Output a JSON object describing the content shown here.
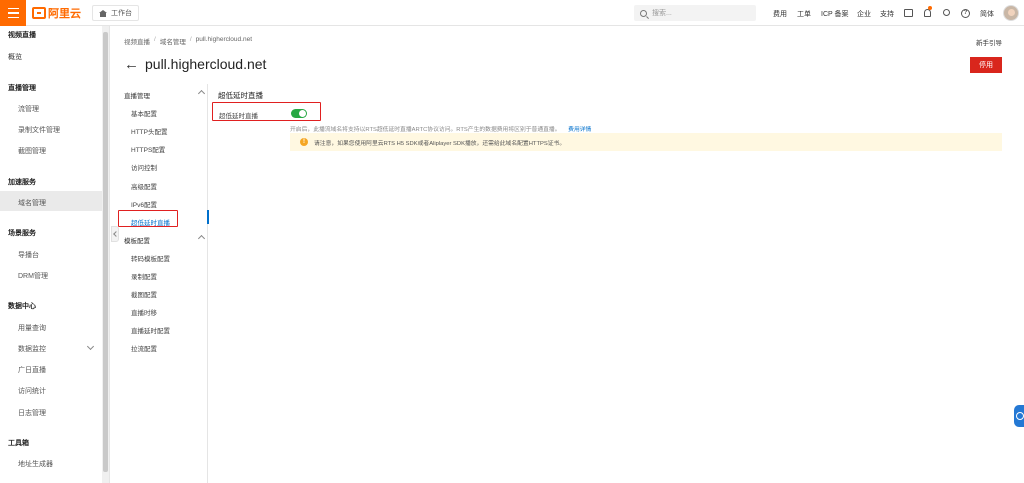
{
  "topbar": {
    "logo_text": "阿里云",
    "workbench_label": "工作台",
    "search_placeholder": "搜索...",
    "nav": [
      "费用",
      "工单",
      "ICP 备案",
      "企业",
      "支持"
    ],
    "lang_label": "简体"
  },
  "sidebar": {
    "items": [
      {
        "label": "视频直播",
        "kind": "group"
      },
      {
        "label": "概览",
        "kind": "item"
      },
      {
        "label": "直播管理",
        "kind": "group"
      },
      {
        "label": "流管理",
        "kind": "sub"
      },
      {
        "label": "录制文件管理",
        "kind": "sub"
      },
      {
        "label": "截图管理",
        "kind": "sub"
      },
      {
        "label": "加速服务",
        "kind": "group"
      },
      {
        "label": "域名管理",
        "kind": "sub",
        "active": true
      },
      {
        "label": "场景服务",
        "kind": "group"
      },
      {
        "label": "导播台",
        "kind": "sub"
      },
      {
        "label": "DRM管理",
        "kind": "sub"
      },
      {
        "label": "数据中心",
        "kind": "group"
      },
      {
        "label": "用量查询",
        "kind": "sub"
      },
      {
        "label": "数据监控",
        "kind": "sub"
      },
      {
        "label": "广日直播",
        "kind": "sub"
      },
      {
        "label": "访问统计",
        "kind": "sub"
      },
      {
        "label": "日志管理",
        "kind": "sub"
      },
      {
        "label": "工具箱",
        "kind": "group"
      },
      {
        "label": "地址生成器",
        "kind": "sub"
      }
    ]
  },
  "breadcrumb": [
    "视频直播",
    "域名管理",
    "pull.highercloud.net"
  ],
  "guide_link": "新手引导",
  "page_title": "pull.highercloud.net",
  "stop_button": "停用",
  "subnav": {
    "groups": [
      {
        "label": "直播管理",
        "items": [
          "基本配置",
          "HTTP头配置",
          "HTTPS配置",
          "访问控制",
          "高级配置",
          "IPv6配置",
          "超低延时直播"
        ]
      },
      {
        "label": "模板配置",
        "items": [
          "转码模板配置",
          "录制配置",
          "截图配置",
          "直播时移",
          "直播延时配置",
          "拉流配置"
        ]
      }
    ],
    "active": "超低延时直播"
  },
  "section": {
    "title": "超低延时直播",
    "setting_label": "超低延时直播",
    "toggle_on": true,
    "description": "开启后，此播流域名将支持以RTS超低延时直播ARTC协议访问。RTS产生的数据费用将区别于普通直播。",
    "description_link": "费用详情",
    "notice": "请注意，如果您使用阿里云RTS H5 SDK或者Aliplayer SDK播放，还需给此域名配置HTTPS证书。"
  },
  "colors": {
    "brand": "#ff6a00",
    "danger": "#d9261c",
    "toggle_on": "#27a844",
    "link": "#0070cc",
    "notice_bg": "#fff8e1"
  }
}
